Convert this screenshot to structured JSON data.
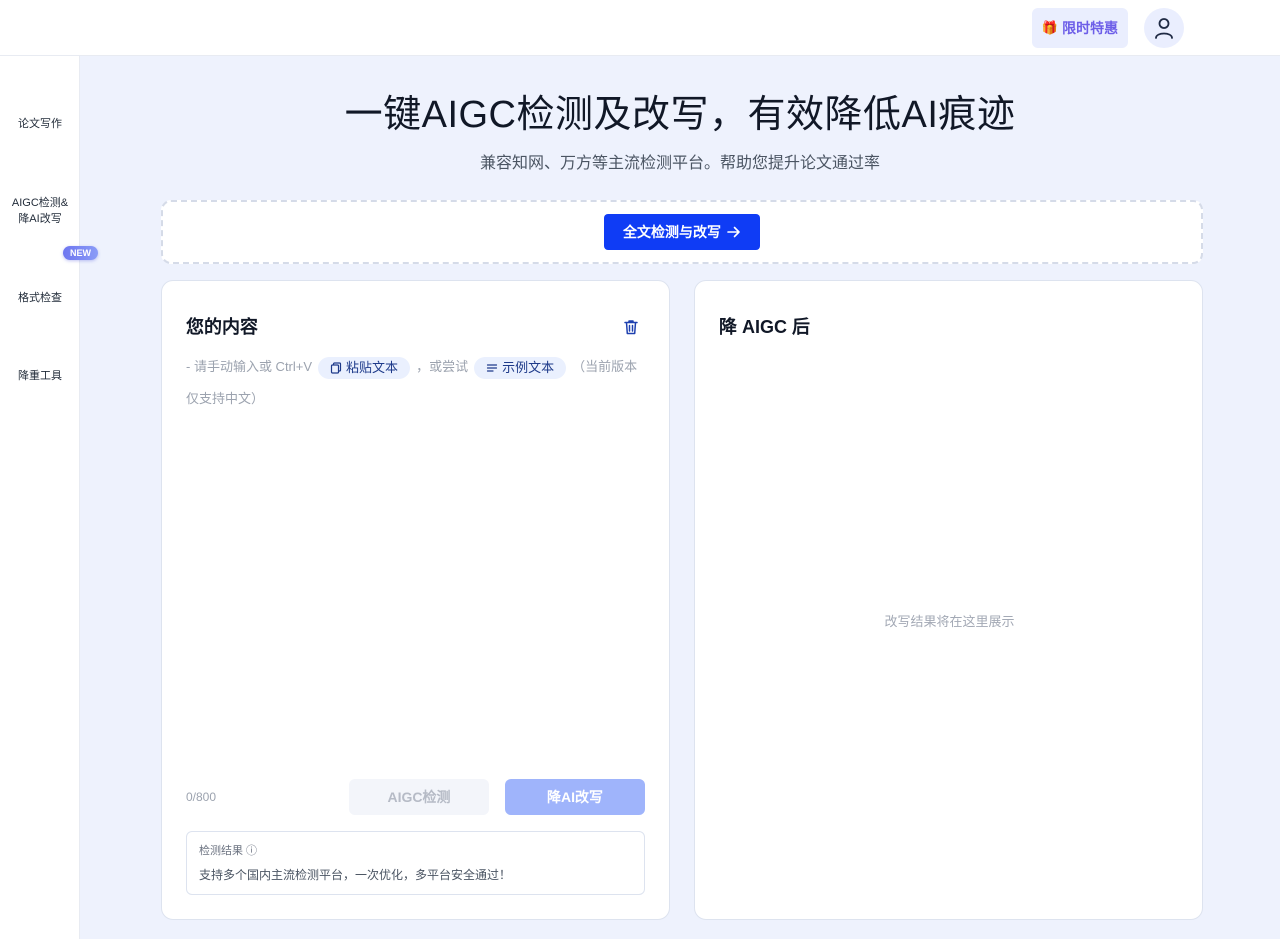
{
  "header": {
    "promo_label": "限时特惠",
    "promo_icon": "gift-icon",
    "avatar_icon": "user-icon",
    "brand_color": "#6d5ee8"
  },
  "sidebar": {
    "items": [
      {
        "lines": [
          "论文写作"
        ]
      },
      {
        "lines": [
          "AIGC检测&",
          "降AI改写"
        ],
        "badge": "NEW"
      },
      {
        "lines": [
          "格式检查"
        ]
      },
      {
        "lines": [
          "降重工具"
        ]
      }
    ]
  },
  "hero": {
    "title": "一键AIGC检测及改写，有效降低AI痕迹",
    "subtitle": "兼容知网、万方等主流检测平台。帮助您提升论文通过率"
  },
  "upload": {
    "button_label": "全文检测与改写",
    "button_icon": "arrow-right-icon",
    "accent_color": "#0f3cf5"
  },
  "input_panel": {
    "title": "您的内容",
    "clear_icon": "trash-icon",
    "hint_prefix": "- 请手动输入或 Ctrl+V",
    "paste_label": "粘贴文本",
    "hint_middle": "，或尝试",
    "sample_label": "示例文本",
    "hint_suffix": "（当前版本仅支持中文）",
    "counter": "0/800",
    "detect_label": "AIGC检测",
    "rewrite_label": "降AI改写",
    "result_label": "检测结果 ⓘ",
    "result_text": "支持多个国内主流检测平台，一次优化，多平台安全通过！"
  },
  "output_panel": {
    "title": "降 AIGC 后",
    "placeholder": "改写结果将在这里展示"
  }
}
